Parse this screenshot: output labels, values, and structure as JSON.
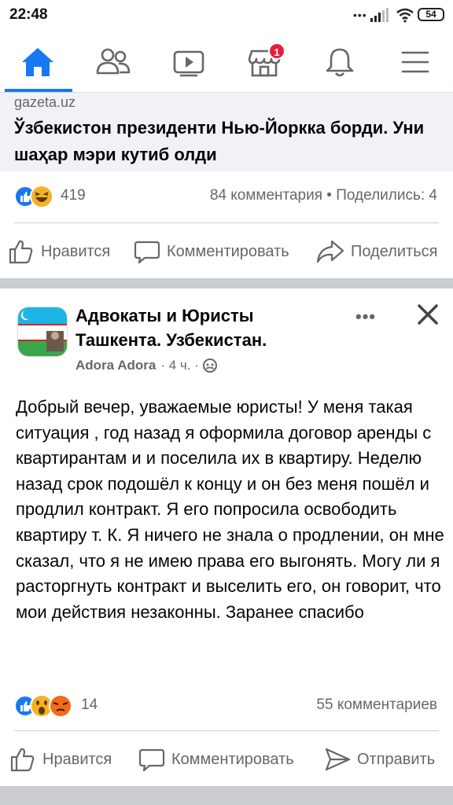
{
  "status_bar": {
    "time": "22:48",
    "dots": "•••",
    "battery": "54"
  },
  "nav": {
    "tabs": [
      "home",
      "friends",
      "watch",
      "marketplace",
      "notifications",
      "menu"
    ],
    "marketplace_badge": "1"
  },
  "shared_post": {
    "link_domain": "gazeta.uz",
    "link_title": "Ўзбекистон президенти Нью-Йоркка борди. Уни шаҳар мэри кутиб олди",
    "reaction_count": "419",
    "comments_shares": "84 комментария • Поделились: 4",
    "actions": {
      "like": "Нравится",
      "comment": "Комментировать",
      "share": "Поделиться"
    }
  },
  "group_post": {
    "group_name": "Адвокаты и Юристы Ташкента. Узбекистан.",
    "author": "Adora Adora",
    "time": "· 4 ч. ·",
    "more": "•••",
    "text": "Добрый вечер, уважаемые  юристы! У меня такая ситуация , год назад я оформила договор аренды с квартирантам и и поселила их в квартиру.  Неделю назад срок подошёл к концу и он без  меня  пошёл и продлил контракт. Я его попросила освободить квартиру т. К. Я ничего не знала о продлении,  он мне сказал, что я не имею права его выгонять. Могу ли я расторгнуть контракт и выселить его, он говорит, что мои действия незаконны. Заранее спасибо",
    "reaction_count": "14",
    "comments": "55 комментариев",
    "actions": {
      "like": "Нравится",
      "comment": "Комментировать",
      "send": "Отправить"
    }
  },
  "colors": {
    "accent": "#1877f2",
    "secondary_text": "#65676b",
    "separator": "#c9ccd1",
    "badge": "#e41e3f"
  }
}
